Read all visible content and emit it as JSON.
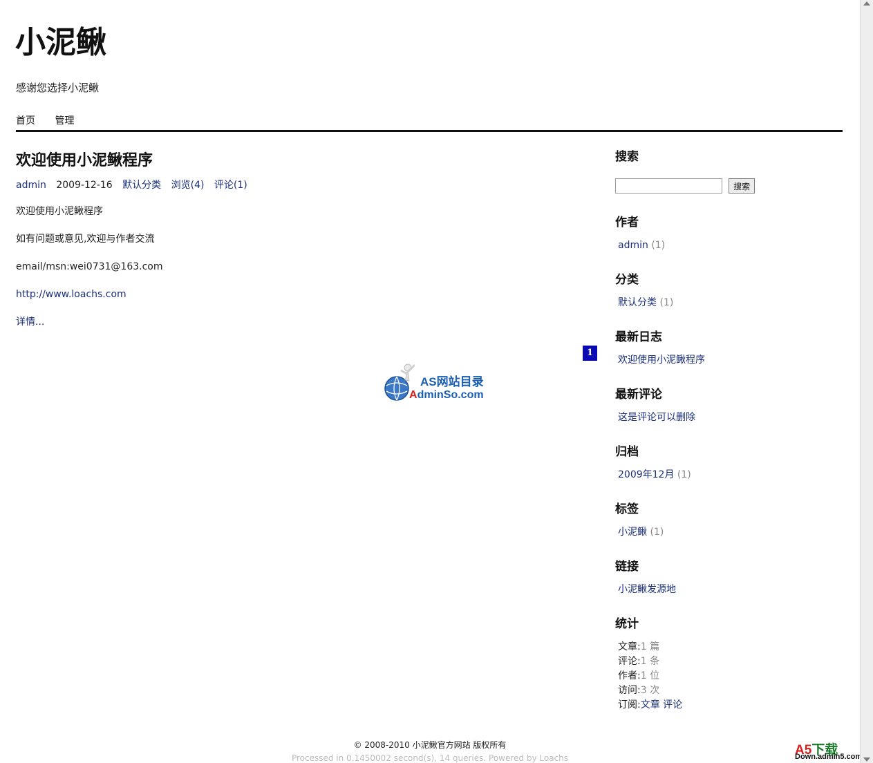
{
  "header": {
    "site_title": "小泥鳅",
    "site_desc": "感谢您选择小泥鳅",
    "nav": [
      "首页",
      "管理"
    ]
  },
  "post": {
    "title": "欢迎使用小泥鳅程序",
    "meta": {
      "author": "admin",
      "date": "2009-12-16",
      "category": "默认分类",
      "views": "浏览(4)",
      "comments": "评论(1)"
    },
    "body": [
      "欢迎使用小泥鳅程序",
      "如有问题或意见,欢迎与作者交流",
      "email/msn:wei0731@163.com"
    ],
    "link": "http://www.loachs.com",
    "more": "详情..."
  },
  "pagination": {
    "current": "1"
  },
  "sidebar": {
    "search": {
      "title": "搜索",
      "button": "搜索",
      "value": ""
    },
    "author": {
      "title": "作者",
      "name": "admin",
      "count": "(1)"
    },
    "category": {
      "title": "分类",
      "name": "默认分类",
      "count": "(1)"
    },
    "recent_posts": {
      "title": "最新日志",
      "item": "欢迎使用小泥鳅程序"
    },
    "recent_comments": {
      "title": "最新评论",
      "item": "这是评论可以删除"
    },
    "archive": {
      "title": "归档",
      "item": "2009年12月",
      "count": "(1)"
    },
    "tags": {
      "title": "标签",
      "item": "小泥鳅",
      "count": "(1)"
    },
    "links": {
      "title": "链接",
      "item": "小泥鳅发源地"
    },
    "stats": {
      "title": "统计",
      "rows": [
        {
          "label": "文章:",
          "value": "1 篇"
        },
        {
          "label": "评论:",
          "value": "1 条"
        },
        {
          "label": "作者:",
          "value": "1 位"
        },
        {
          "label": "访问:",
          "value": "3 次"
        }
      ],
      "subscribe_label": "订阅:",
      "subscribe_posts": "文章",
      "subscribe_comments": "评论"
    }
  },
  "footer": {
    "copyright": "© 2008-2010 小泥鳅官方网站  版权所有",
    "processed": "Processed in 0.1450002 second(s), 14 queries. Powered by Loachs"
  },
  "watermarks": {
    "center_line1": "AS网站目录",
    "center_line2_red": "A",
    "center_line2_rest": "dminSo.com",
    "corner_a5": "A5",
    "corner_xiazai": "下载",
    "corner_domain": "Down.admin5.com"
  }
}
